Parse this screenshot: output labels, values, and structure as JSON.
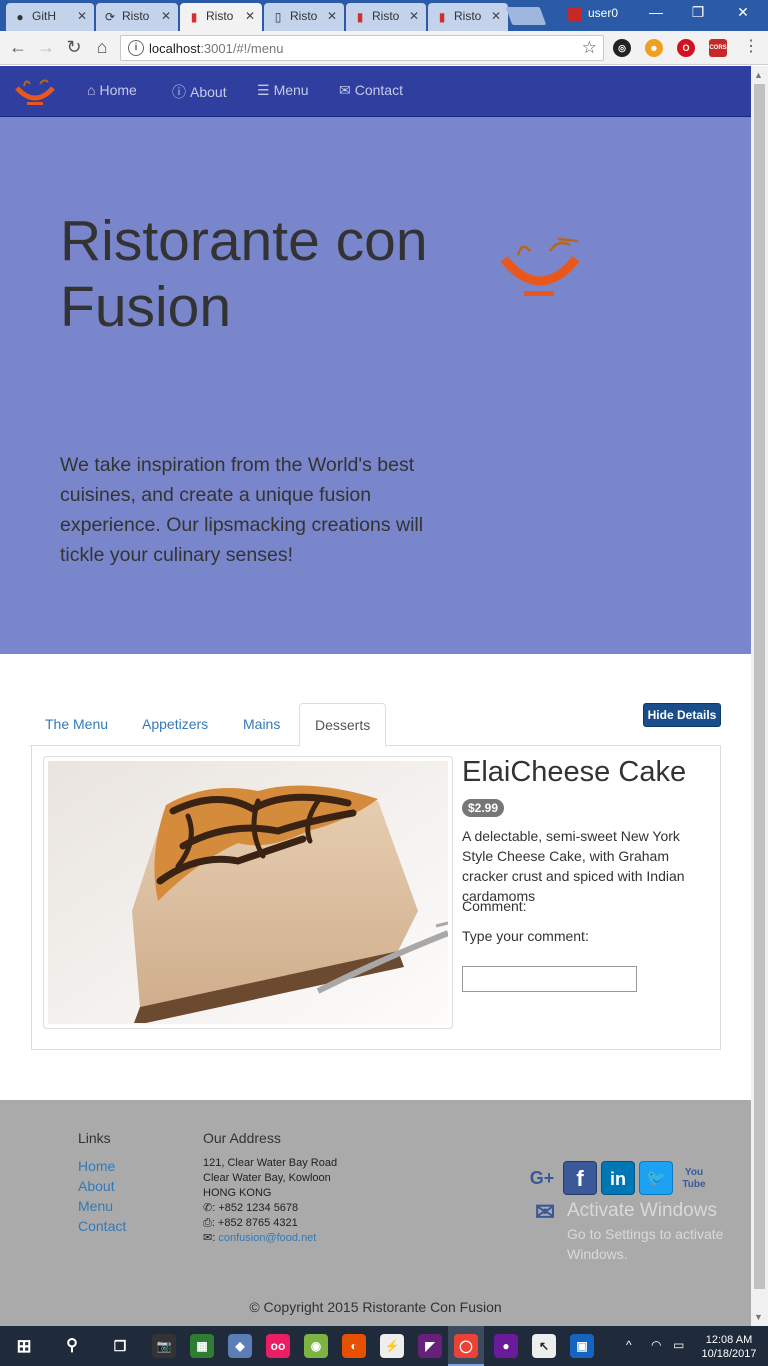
{
  "browser": {
    "tabs": [
      {
        "title": "GitH",
        "icon": "github-icon"
      },
      {
        "title": "Risto",
        "icon": "loop-icon"
      },
      {
        "title": "Risto",
        "icon": "bootstrap-icon",
        "active": true
      },
      {
        "title": "Risto",
        "icon": "doc-icon"
      },
      {
        "title": "Risto",
        "icon": "bootstrap-icon"
      },
      {
        "title": "Risto",
        "icon": "bootstrap-icon"
      }
    ],
    "profile": "user0",
    "url_host": "localhost",
    "url_path": ":3001/#!/menu",
    "extensions": [
      {
        "name": "circle-extension-icon",
        "label": "◎",
        "color": "#222222"
      },
      {
        "name": "emoji-extension-icon",
        "label": "☻",
        "color": "#f0a020"
      },
      {
        "name": "opera-extension-icon",
        "label": "O",
        "color": "#d31121"
      },
      {
        "name": "cors-extension-icon",
        "label": "CORS",
        "color": "#c62828"
      }
    ]
  },
  "navbar": {
    "items": [
      {
        "label": "Home",
        "icon": "home-icon"
      },
      {
        "label": "About",
        "icon": "info-icon"
      },
      {
        "label": "Menu",
        "icon": "list-icon"
      },
      {
        "label": "Contact",
        "icon": "envelope-icon"
      }
    ]
  },
  "jumbotron": {
    "title": "Ristorante con Fusion",
    "tagline": "We take inspiration from the World's best cuisines, and create a unique fusion experience. Our lipsmacking creations will tickle your culinary senses!"
  },
  "menu": {
    "tabs": [
      "The Menu",
      "Appetizers",
      "Mains",
      "Desserts"
    ],
    "active_tab": "Desserts",
    "hide_details_label": "Hide Details",
    "dish": {
      "name": "ElaiCheese Cake",
      "price": "$2.99",
      "description": "A delectable, semi-sweet New York Style Cheese Cake, with Graham cracker crust and spiced with Indian cardamoms",
      "comment_label": "Comment:",
      "type_label": "Type your comment:",
      "comment_value": ""
    }
  },
  "footer": {
    "links_heading": "Links",
    "links": [
      "Home",
      "About",
      "Menu",
      "Contact"
    ],
    "address_heading": "Our Address",
    "address_lines": [
      "121, Clear Water Bay Road",
      "Clear Water Bay, Kowloon",
      "HONG KONG"
    ],
    "phone": ": +852 1234 5678",
    "fax": ": +852 8765 4321",
    "email": "confusion@food.net",
    "email_prefix": ":",
    "social": [
      {
        "name": "google-plus-icon",
        "label": "G+",
        "color": "#3b5998",
        "bg": "transparent"
      },
      {
        "name": "facebook-icon",
        "label": "f",
        "color": "#ffffff",
        "bg": "#3b5998"
      },
      {
        "name": "linkedin-icon",
        "label": "in",
        "color": "#ffffff",
        "bg": "#0077b5"
      },
      {
        "name": "twitter-icon",
        "label": "🐦",
        "color": "#ffffff",
        "bg": "#1da1f2"
      },
      {
        "name": "youtube-icon",
        "label": "You Tube",
        "color": "#3b5998",
        "bg": "transparent"
      }
    ],
    "activate_title": "Activate Windows",
    "activate_sub": "Go to Settings to activate Windows.",
    "copyright": "© Copyright 2015 Ristorante Con Fusion"
  },
  "taskbar": {
    "time": "12:08 AM",
    "date": "10/18/2017",
    "apps": [
      {
        "name": "camera-app-icon",
        "color": "#333333",
        "label": "📷"
      },
      {
        "name": "tiles-app-icon",
        "color": "#2e7d32",
        "label": "▦"
      },
      {
        "name": "cube-app-icon",
        "color": "#5c7db5",
        "label": "◆"
      },
      {
        "name": "flickr-app-icon",
        "color": "#e91e63",
        "label": "oo"
      },
      {
        "name": "android-app-icon",
        "color": "#7cb342",
        "label": "◉"
      },
      {
        "name": "firefox-app-icon",
        "color": "#e65100",
        "label": "◐"
      },
      {
        "name": "lightning-app-icon",
        "color": "#eeeeee",
        "label": "⚡"
      },
      {
        "name": "visual-studio-app-icon",
        "color": "#68217a",
        "label": "◤"
      },
      {
        "name": "chrome-app-icon",
        "color": "#ea4335",
        "label": "◯"
      },
      {
        "name": "cat-app-icon",
        "color": "#6a1b9a",
        "label": "●"
      },
      {
        "name": "cursor-app-icon",
        "color": "#eeeeee",
        "label": "↖"
      },
      {
        "name": "remote-app-icon",
        "color": "#1565c0",
        "label": "▣"
      }
    ]
  }
}
